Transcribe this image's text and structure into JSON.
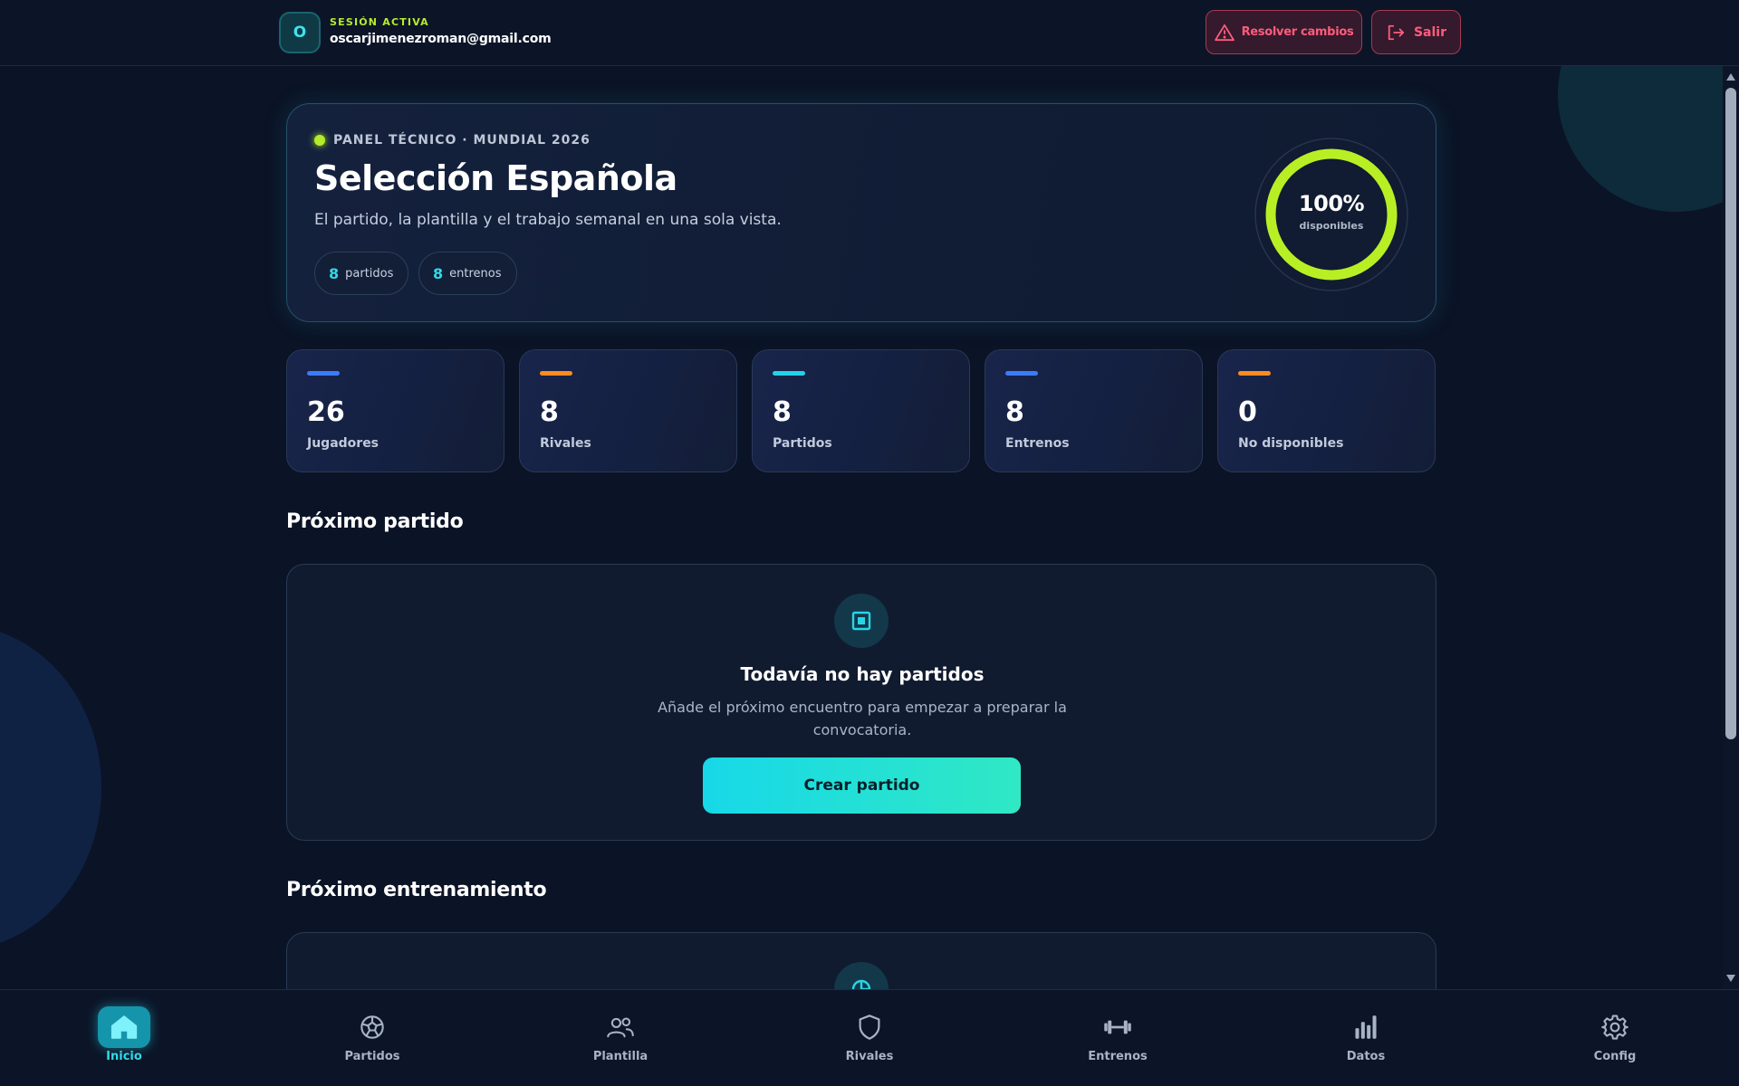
{
  "session": {
    "avatar_initial": "O",
    "label": "SESIÓN ACTIVA",
    "email": "oscarjimenezroman@gmail.com"
  },
  "header_actions": {
    "resolve_label": "Resolver cambios",
    "exit_label": "Salir"
  },
  "hero": {
    "kicker": "PANEL TÉCNICO · MUNDIAL 2026",
    "title": "Selección Española",
    "subtitle": "El partido, la plantilla y el trabajo semanal en una sola vista.",
    "pills": [
      {
        "value": "8",
        "label": "partidos"
      },
      {
        "value": "8",
        "label": "entrenos"
      }
    ],
    "availability": {
      "percent_text": "100%",
      "label": "disponibles",
      "fraction": 1.0
    }
  },
  "stats": [
    {
      "value": "26",
      "label": "Jugadores",
      "accent": "#3b7bff"
    },
    {
      "value": "8",
      "label": "Rivales",
      "accent": "#ff8a1f"
    },
    {
      "value": "8",
      "label": "Partidos",
      "accent": "#22d3e6"
    },
    {
      "value": "8",
      "label": "Entrenos",
      "accent": "#3b7bff"
    },
    {
      "value": "0",
      "label": "No disponibles",
      "accent": "#ff8a1f"
    }
  ],
  "next_match": {
    "section_title": "Próximo partido",
    "empty_title": "Todavía no hay partidos",
    "empty_text": "Añade el próximo encuentro para empezar a preparar la convocatoria.",
    "button_label": "Crear partido"
  },
  "next_training": {
    "section_title": "Próximo entrenamiento"
  },
  "nav": [
    {
      "label": "Inicio",
      "icon": "home-icon",
      "active": true
    },
    {
      "label": "Partidos",
      "icon": "soccer-ball-icon",
      "active": false
    },
    {
      "label": "Plantilla",
      "icon": "users-icon",
      "active": false
    },
    {
      "label": "Rivales",
      "icon": "shield-icon",
      "active": false
    },
    {
      "label": "Entrenos",
      "icon": "dumbbell-icon",
      "active": false
    },
    {
      "label": "Datos",
      "icon": "bar-chart-icon",
      "active": false
    },
    {
      "label": "Config",
      "icon": "gear-icon",
      "active": false
    }
  ],
  "colors": {
    "accent_cyan": "#2fdcea",
    "accent_lime": "#b5ec2a",
    "danger": "#ff5c7d",
    "background": "#0b1326"
  }
}
